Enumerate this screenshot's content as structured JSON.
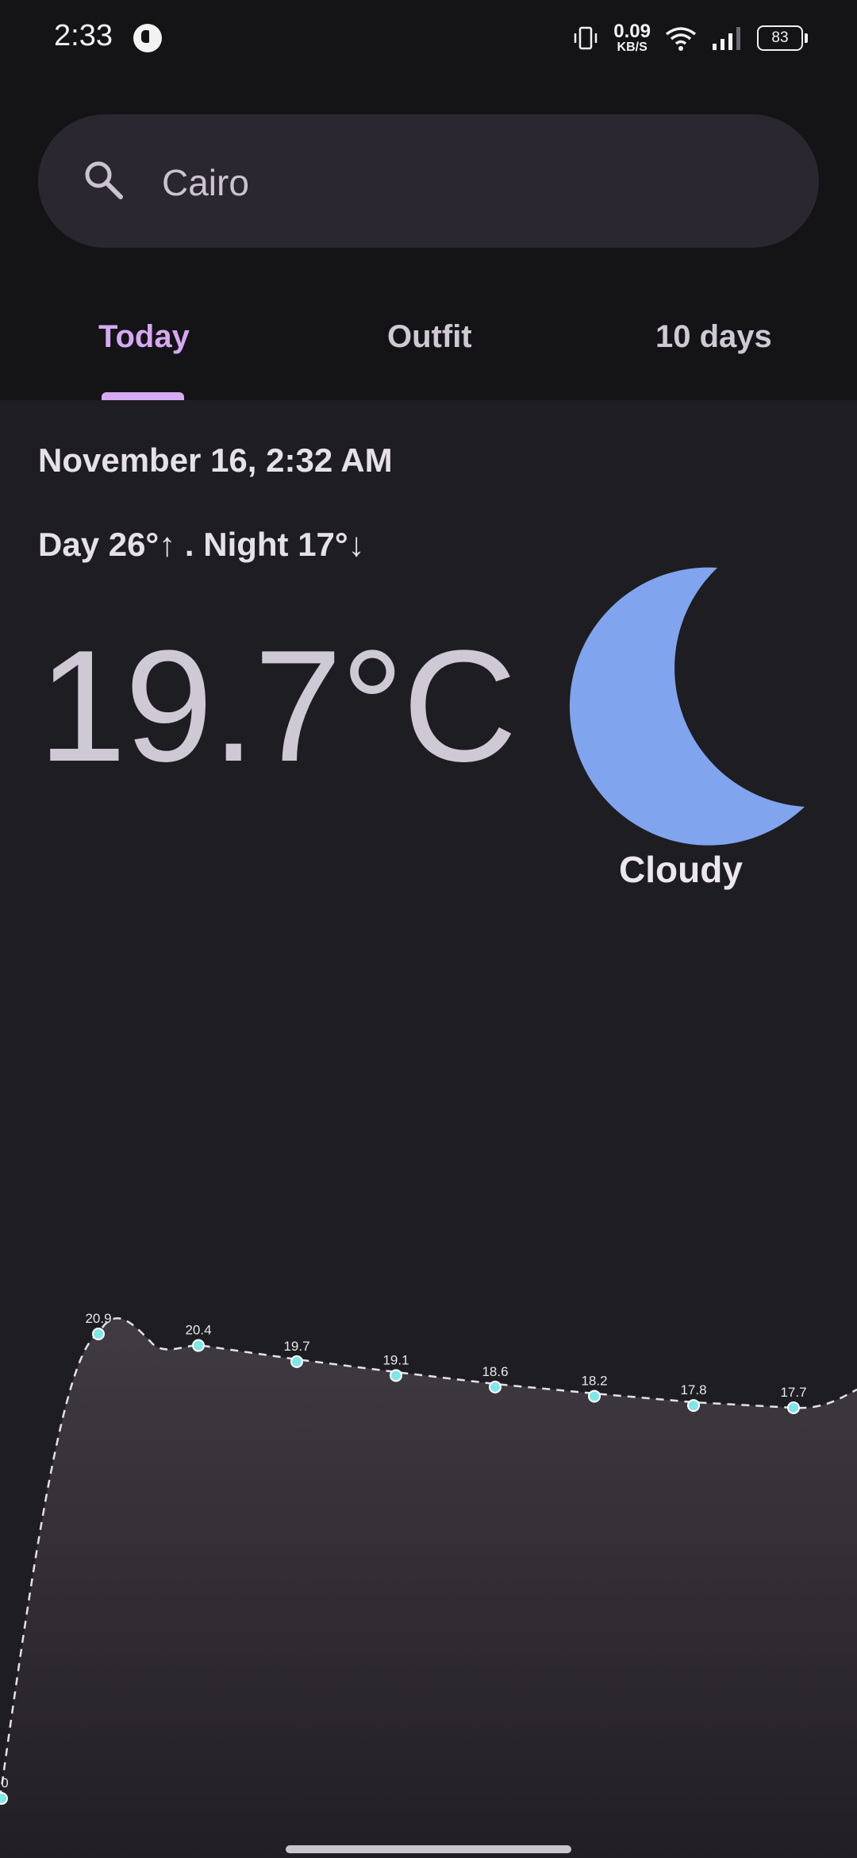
{
  "status_bar": {
    "time": "2:33",
    "net_speed_value": "0.09",
    "net_speed_unit": "KB/S",
    "battery": "83"
  },
  "search": {
    "value": "Cairo"
  },
  "tabs": [
    {
      "label": "Today",
      "selected": true
    },
    {
      "label": "Outfit",
      "selected": false
    },
    {
      "label": "10 days",
      "selected": false
    }
  ],
  "weather": {
    "datetime": "November 16, 2:32 AM",
    "day_night": "Day 26°↑ . Night 17°↓",
    "temperature": "19.7°C",
    "condition": "Cloudy",
    "condition_icon": "crescent-moon-icon"
  },
  "colors": {
    "accent": "#d6a9f2",
    "moon": "#80a4ee",
    "point": "#7fe6ea"
  },
  "chart_data": {
    "type": "area",
    "labels": [
      "0",
      "20.9",
      "20.4",
      "19.7",
      "19.1",
      "18.6",
      "18.2",
      "17.8",
      "17.7"
    ],
    "values": [
      null,
      20.9,
      20.4,
      19.7,
      19.1,
      18.6,
      18.2,
      17.8,
      17.7
    ],
    "grid": false
  }
}
